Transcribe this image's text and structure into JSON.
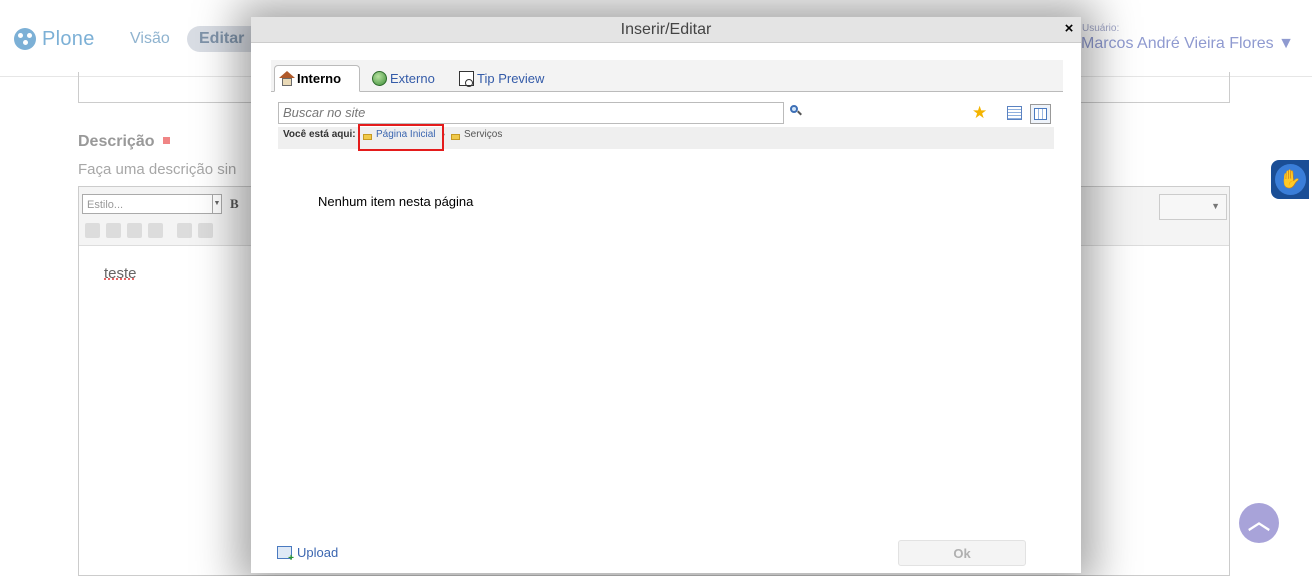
{
  "background": {
    "logo_text": "Plone",
    "nav": {
      "view_label": "Visão",
      "edit_label": "Editar"
    },
    "user": {
      "label": "Usuário:",
      "name": "Marcos André Vieira Flores ▼"
    },
    "description_field": {
      "label": "Descrição",
      "help_text": "Faça uma descrição sin",
      "style_select_placeholder": "Estilo...",
      "bold_label": "B",
      "editor_content": "teste"
    },
    "scroll_top_glyph": "︿",
    "accessibility_glyph": "✋"
  },
  "dialog": {
    "title": "Inserir/Editar",
    "close_glyph": "×",
    "tabs": [
      {
        "label": "Interno",
        "icon": "home-icon",
        "active": true
      },
      {
        "label": "Externo",
        "icon": "globe-icon",
        "active": false
      },
      {
        "label": "Tip Preview",
        "icon": "preview-icon",
        "active": false
      }
    ],
    "search": {
      "placeholder": "Buscar no site"
    },
    "breadcrumb": {
      "label": "Você está aqui:",
      "items": [
        "Página Inicial",
        "Serviços"
      ],
      "separator": "›"
    },
    "empty_message": "Nenhum item nesta página",
    "upload_label": "Upload",
    "ok_label": "Ok"
  },
  "colors": {
    "link": "#3b66b0",
    "highlight": "#e41b1b",
    "brand": "#7cb0d6"
  }
}
